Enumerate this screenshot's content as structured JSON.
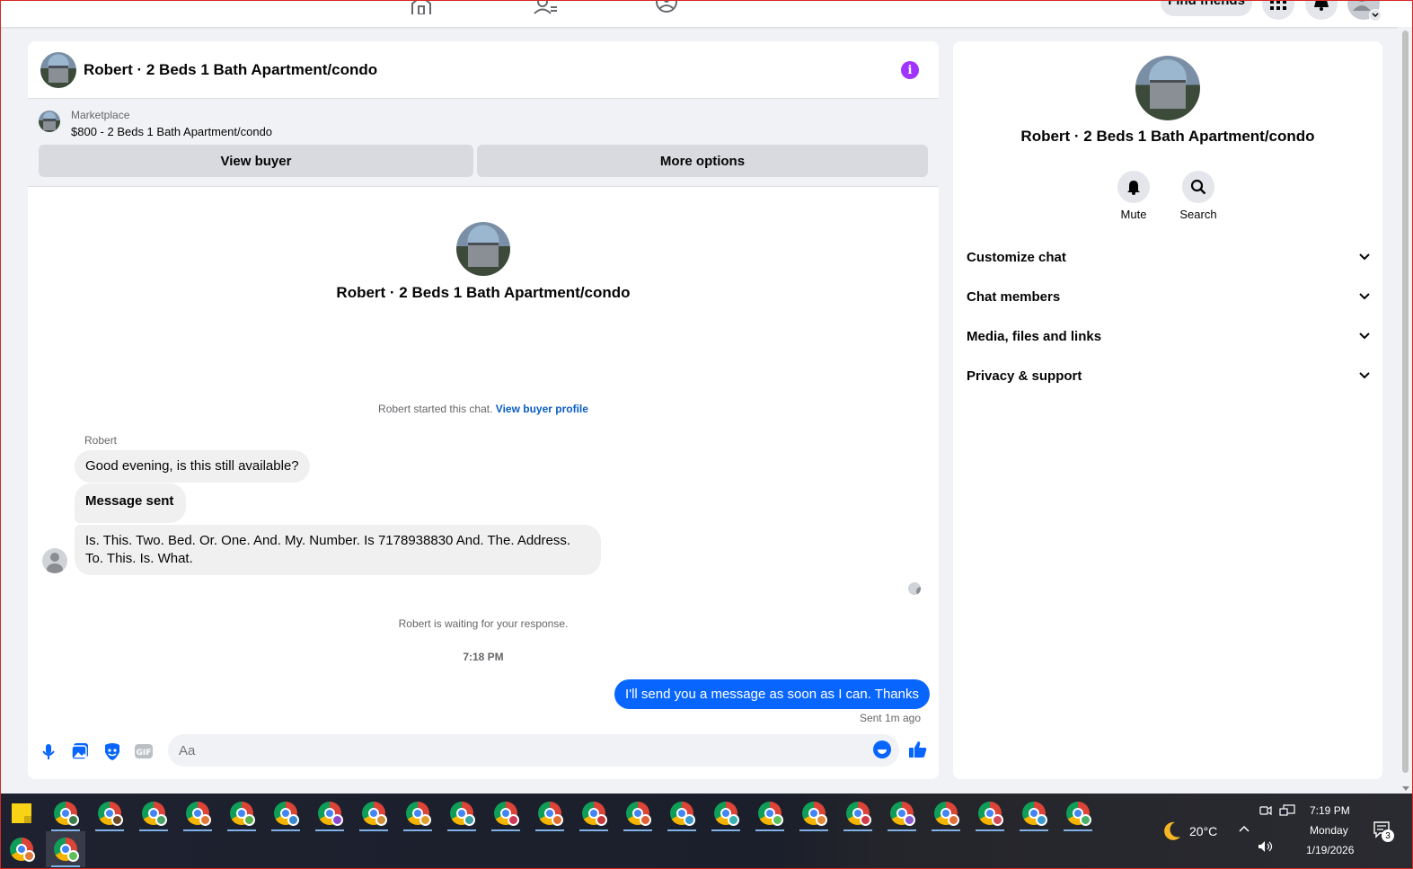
{
  "topnav": {
    "find_friends_label": "Find friends"
  },
  "chat": {
    "title": "Robert · 2 Beds 1 Bath Apartment/condo",
    "marketplace": {
      "label": "Marketplace",
      "listing": "$800 - 2 Beds 1 Bath Apartment/condo",
      "view_buyer_label": "View buyer",
      "more_options_label": "More options"
    },
    "intro_name": "Robert · 2 Beds 1 Bath Apartment/condo",
    "started_text": "Robert started this chat.",
    "view_profile_link": "View buyer profile",
    "sender_name": "Robert",
    "messages": [
      "Good evening, is this still available?",
      "Message sent",
      "Is. This. Two. Bed. Or. One. And. My. Number. Is 7178938830 And. The. Address. To. This. Is. What."
    ],
    "waiting_text": "Robert is waiting for your response.",
    "timestamp": "7:18 PM",
    "outgoing_message": "I'll send you a message as soon as I can. Thanks",
    "sent_status": "Sent 1m ago",
    "composer_placeholder": "Aa"
  },
  "side": {
    "name": "Robert · 2 Beds 1 Bath Apartment/condo",
    "actions": {
      "mute": "Mute",
      "search": "Search"
    },
    "sections": [
      "Customize chat",
      "Chat members",
      "Media, files and links",
      "Privacy & support"
    ]
  },
  "taskbar": {
    "weather": "20°C",
    "time": "7:19 PM",
    "day": "Monday",
    "date": "1/19/2026",
    "notification_count": "3"
  },
  "colors": {
    "accent": "#0866ff",
    "info": "#a033ff"
  }
}
